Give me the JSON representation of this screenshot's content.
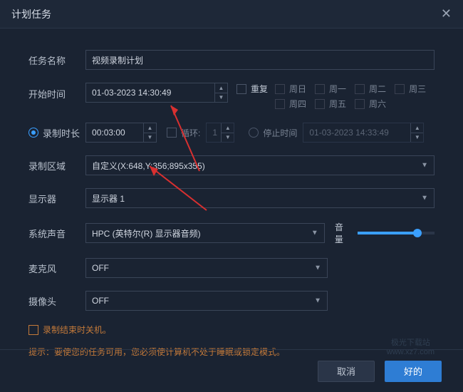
{
  "header": {
    "title": "计划任务",
    "close_icon": "✕"
  },
  "form": {
    "task_name_label": "任务名称",
    "task_name_value": "视频录制计划",
    "start_time_label": "开始时间",
    "start_time_value": "01-03-2023 14:30:49",
    "repeat_label": "重复",
    "weekdays": [
      "周日",
      "周一",
      "周二",
      "周三",
      "周四",
      "周五",
      "周六"
    ],
    "duration_label": "录制时长",
    "duration_value": "00:03:00",
    "loop_label": "循环:",
    "loop_value": "1",
    "stop_time_label": "停止时间",
    "stop_time_value": "01-03-2023 14:33:49",
    "region_label": "录制区域",
    "region_value": "自定义(X:648,Y:356;895x355)",
    "monitor_label": "显示器",
    "monitor_value": "显示器 1",
    "system_audio_label": "系统声音",
    "system_audio_value": "HPC (英特尔(R) 显示器音频)",
    "volume_label": "音量",
    "mic_label": "麦克风",
    "mic_value": "OFF",
    "camera_label": "摄像头",
    "camera_value": "OFF",
    "shutdown_label": "录制结束时关机。",
    "hint": "提示：要使您的任务可用，您必须使计算机不处于睡眠或锁定模式。"
  },
  "footer": {
    "cancel": "取消",
    "ok": "好的"
  },
  "watermark": "极光下载站\nwww.xz7.com",
  "colors": {
    "bg": "#1a2332",
    "accent": "#3a9fff",
    "warn": "#c47a3a",
    "primary_btn": "#2e7dd4"
  }
}
